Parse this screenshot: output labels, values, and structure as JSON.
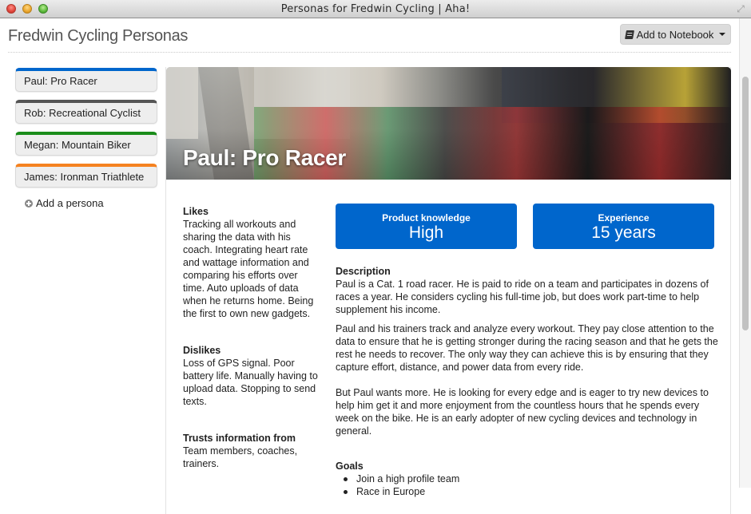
{
  "window": {
    "title": "Personas for Fredwin Cycling | Aha!"
  },
  "header": {
    "title": "Fredwin Cycling Personas",
    "add_to_notebook_label": "Add to Notebook"
  },
  "sidebar": {
    "personas": [
      {
        "label": "Paul: Pro Racer",
        "color": "#0066cc",
        "selected": true
      },
      {
        "label": "Rob: Recreational Cyclist",
        "color": "#555555",
        "selected": false
      },
      {
        "label": "Megan: Mountain Biker",
        "color": "#1a8c1a",
        "selected": false
      },
      {
        "label": "James: Ironman Triathlete",
        "color": "#f58220",
        "selected": false
      }
    ],
    "add_persona_label": "Add a persona"
  },
  "persona": {
    "name": "Paul: Pro Racer",
    "likes": {
      "heading": "Likes",
      "text": "Tracking all workouts and sharing the data with his coach. Integrating heart rate and wattage information and comparing his efforts over time. Auto uploads of data when he returns home. Being the first to own new gadgets."
    },
    "dislikes": {
      "heading": "Dislikes",
      "text": "Loss of GPS signal. Poor battery life. Manually having to upload data. Stopping to send texts."
    },
    "trusts": {
      "heading": "Trusts information from",
      "text": "Team members, coaches, trainers."
    },
    "stats": [
      {
        "label": "Product knowledge",
        "value": "High"
      },
      {
        "label": "Experience",
        "value": "15 years"
      }
    ],
    "description": {
      "heading": "Description",
      "paragraphs": [
        "Paul is a Cat. 1 road racer. He is paid to ride on a team and participates in dozens of races a year. He considers cycling his full-time job, but does work part-time to help supplement his income.",
        "Paul and his trainers track and analyze every workout. They pay close attention to the data to ensure that he is getting stronger during the racing season and that he gets the rest he needs to recover. The only way they can achieve this is by ensuring that they capture effort, distance, and power data from every ride.",
        "But Paul wants more. He is looking for every edge and is eager to try new devices to help him get it and more enjoyment from the countless hours that he spends every week on the bike. He is an early adopter of new cycling devices and technology in general."
      ]
    },
    "goals": {
      "heading": "Goals",
      "items": [
        "Join a high profile team",
        "Race in Europe"
      ]
    }
  },
  "colors": {
    "accent": "#0066cc"
  }
}
